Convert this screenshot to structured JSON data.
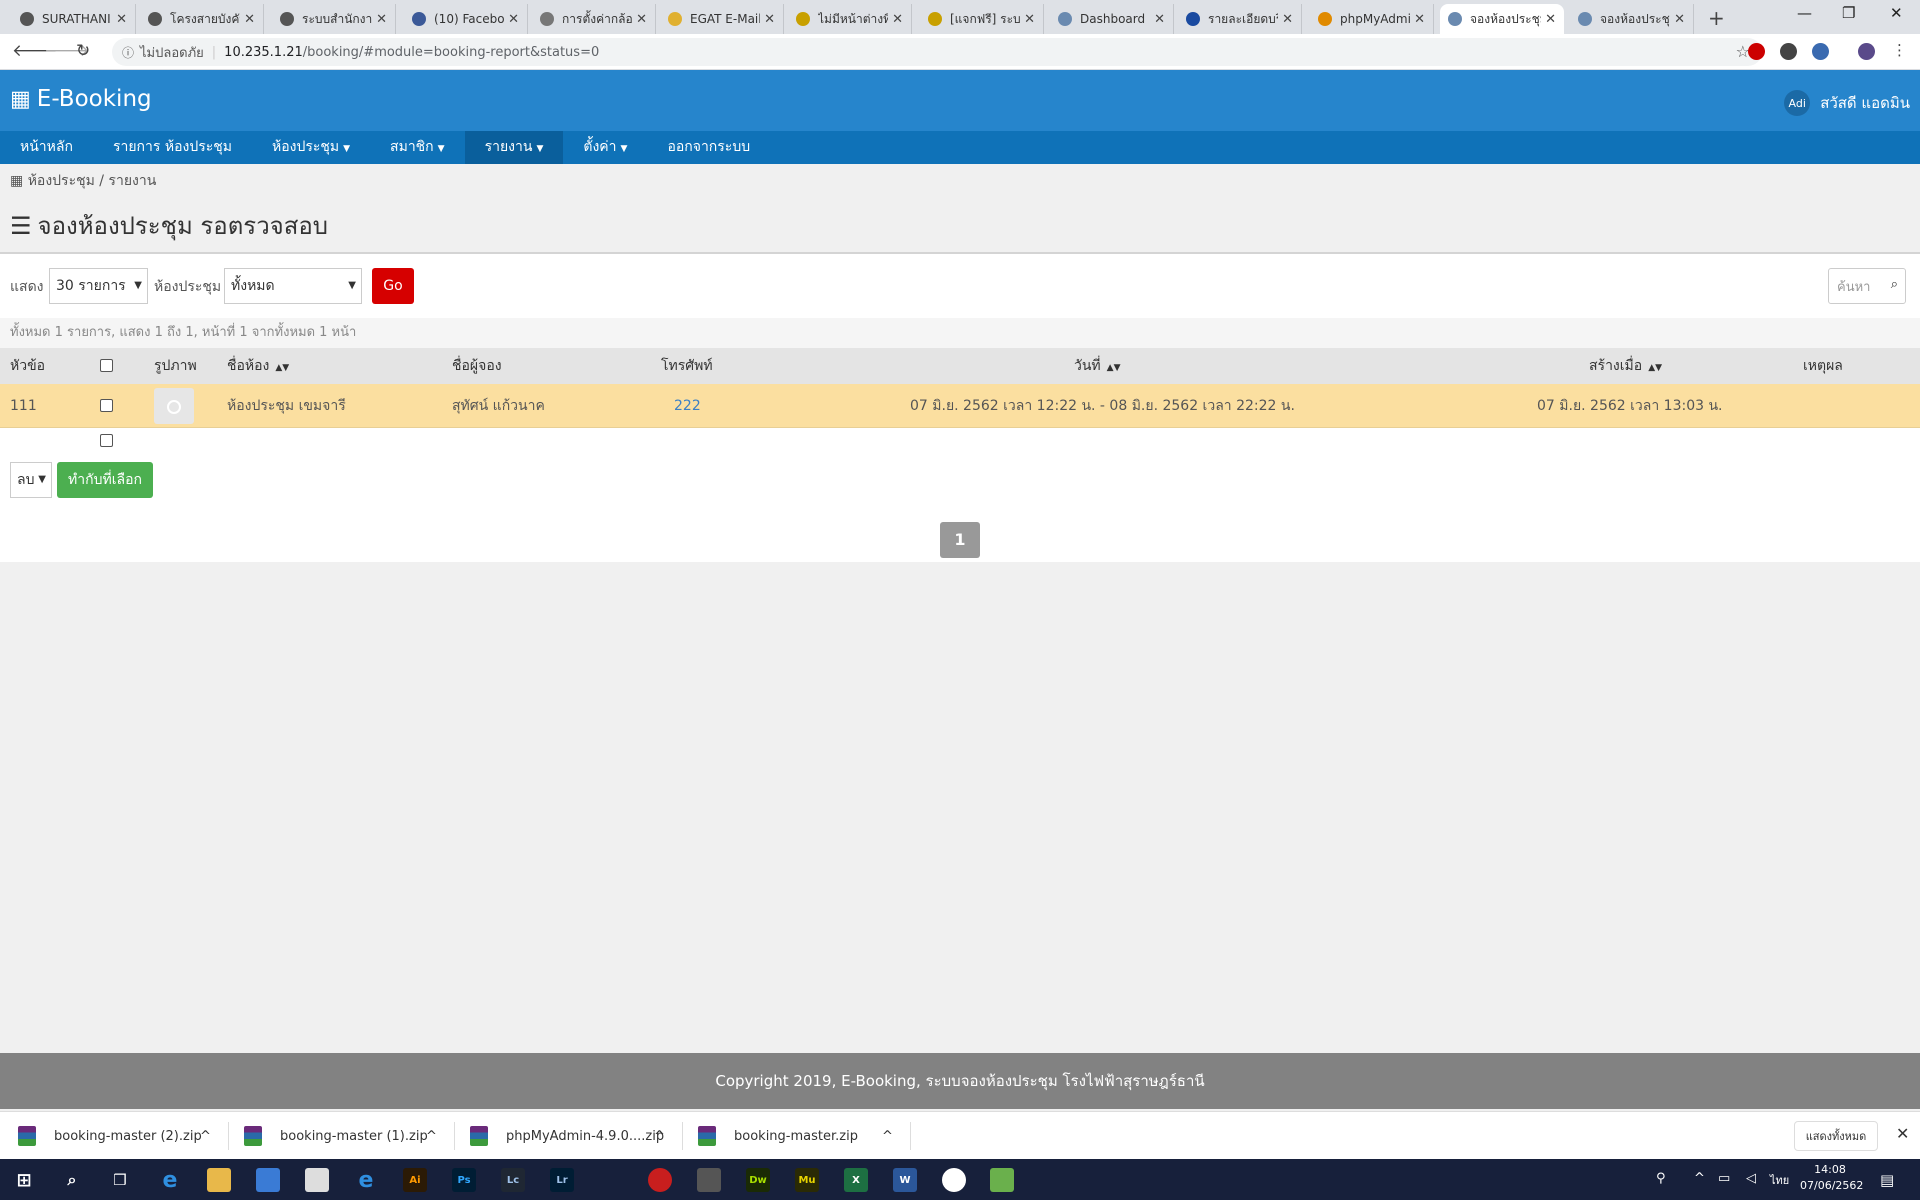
{
  "browser": {
    "tabs": [
      {
        "title": "SURATHANI",
        "icon": "globe-icon"
      },
      {
        "title": "โครงสายบังคับบ",
        "icon": "globe-icon"
      },
      {
        "title": "ระบบสำนักงาน",
        "icon": "globe-icon"
      },
      {
        "title": "(10) Faceboo",
        "icon": "facebook-icon"
      },
      {
        "title": "การตั้งค่ากล้อง",
        "icon": "camera-icon"
      },
      {
        "title": "EGAT E-Mail",
        "icon": "egat-icon"
      },
      {
        "title": "ไม่มีหน้าต่างที่",
        "icon": "wsr-icon"
      },
      {
        "title": "[แจกฟรี] ระบบ",
        "icon": "wsr-icon"
      },
      {
        "title": "Dashboard",
        "icon": "elephant-icon"
      },
      {
        "title": "รายละเอียดบริ",
        "icon": "l-icon"
      },
      {
        "title": "phpMyAdmin",
        "icon": "pma-icon"
      },
      {
        "title": "จองห้องประชุม",
        "icon": "elephant-icon",
        "active": true
      },
      {
        "title": "จองห้องประชุม",
        "icon": "elephant-icon"
      }
    ],
    "close_glyph": "✕",
    "new_tab_glyph": "+",
    "window_controls": [
      "—",
      "❐",
      "✕"
    ],
    "security_label": "ไม่ปลอดภัย",
    "url_host": "10.235.1.21",
    "url_path": "/booking/#module=booking-report&status=0"
  },
  "app": {
    "brand": "E-Booking",
    "user_initials": "Adi",
    "user_name": "สวัสดี แอดมิน",
    "nav": [
      {
        "label": "หน้าหลัก",
        "dropdown": false
      },
      {
        "label": "รายการ ห้องประชุม",
        "dropdown": false
      },
      {
        "label": "ห้องประชุม",
        "dropdown": true
      },
      {
        "label": "สมาชิก",
        "dropdown": true
      },
      {
        "label": "รายงาน",
        "dropdown": true,
        "active": true
      },
      {
        "label": "ตั้งค่า",
        "dropdown": true
      },
      {
        "label": "ออกจากระบบ",
        "dropdown": false
      }
    ],
    "breadcrumb": "ห้องประชุม / รายงาน",
    "page_title": "จองห้องประชุม รอตรวจสอบ"
  },
  "filters": {
    "show_label": "แสดง",
    "show_value": "30 รายการ",
    "room_label": "ห้องประชุม",
    "room_value": "ทั้งหมด",
    "go_label": "Go",
    "search_placeholder": "ค้นหา"
  },
  "table": {
    "summary": "ทั้งหมด 1 รายการ, แสดง 1 ถึง 1, หน้าที่ 1 จากทั้งหมด 1 หน้า",
    "columns": {
      "topic": "หัวข้อ",
      "image": "รูปภาพ",
      "room": "ชื่อห้อง",
      "booker": "ชื่อผู้จอง",
      "phone": "โทรศัพท์",
      "date": "วันที่",
      "created": "สร้างเมื่อ",
      "reason": "เหตุผล"
    },
    "rows": [
      {
        "topic": "111",
        "room": "ห้องประชุม เขมจารี",
        "booker": "สุทัศน์ แก้วนาค",
        "phone": "222",
        "date": "07 มิ.ย. 2562 เวลา 12:22 น. - 08 มิ.ย. 2562 เวลา 22:22 น.",
        "created": "07 มิ.ย. 2562 เวลา 13:03 น.",
        "reason": ""
      }
    ],
    "action_value": "ลบ",
    "apply_label": "ทำกับที่เลือก",
    "page": "1"
  },
  "footer": "Copyright 2019, E-Booking, ระบบจองห้องประชุม โรงไฟฟ้าสุราษฎร์ธานี",
  "downloads": {
    "items": [
      "booking-master (2).zip",
      "booking-master (1).zip",
      "phpMyAdmin-4.9.0....zip",
      "booking-master.zip"
    ],
    "show_all": "แสดงทั้งหมด",
    "close_glyph": "✕"
  },
  "taskbar": {
    "apps": [
      {
        "label": "Ai",
        "color": "#2b1a05",
        "fg": "#ff9a00"
      },
      {
        "label": "Ps",
        "color": "#001d34",
        "fg": "#31a8ff"
      },
      {
        "label": "Lc",
        "color": "#1f2733",
        "fg": "#9fc1e8"
      },
      {
        "label": "Lr",
        "color": "#001d34",
        "fg": "#9fc1e8"
      },
      {
        "label": "Dw",
        "color": "#1a2a05",
        "fg": "#a8e000"
      },
      {
        "label": "Mu",
        "color": "#2a2a05",
        "fg": "#e8d400"
      },
      {
        "label": "X",
        "color": "#1d6f42",
        "fg": "#ffffff"
      },
      {
        "label": "W",
        "color": "#2b579a",
        "fg": "#ffffff"
      }
    ],
    "language": "ไทย",
    "time": "14:08",
    "date": "07/06/2562"
  }
}
